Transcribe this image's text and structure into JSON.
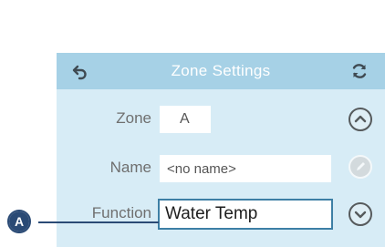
{
  "header": {
    "title": "Zone Settings"
  },
  "rows": {
    "zone": {
      "label": "Zone",
      "value": "A"
    },
    "name": {
      "label": "Name",
      "value": "<no name>"
    },
    "function": {
      "label": "Function",
      "value": "Water Temp"
    }
  },
  "callout": {
    "label": "A"
  },
  "icons": {
    "back": "back-arrow-icon",
    "refresh": "refresh-icon",
    "up": "chevron-up-circle-icon",
    "edit": "pencil-circle-icon",
    "down": "chevron-down-circle-icon"
  },
  "colors": {
    "screen_bg": "#d7ecf6",
    "header_bg": "#a6d1e6",
    "selection_border": "#3d7fa5",
    "callout": "#2a4a75"
  }
}
